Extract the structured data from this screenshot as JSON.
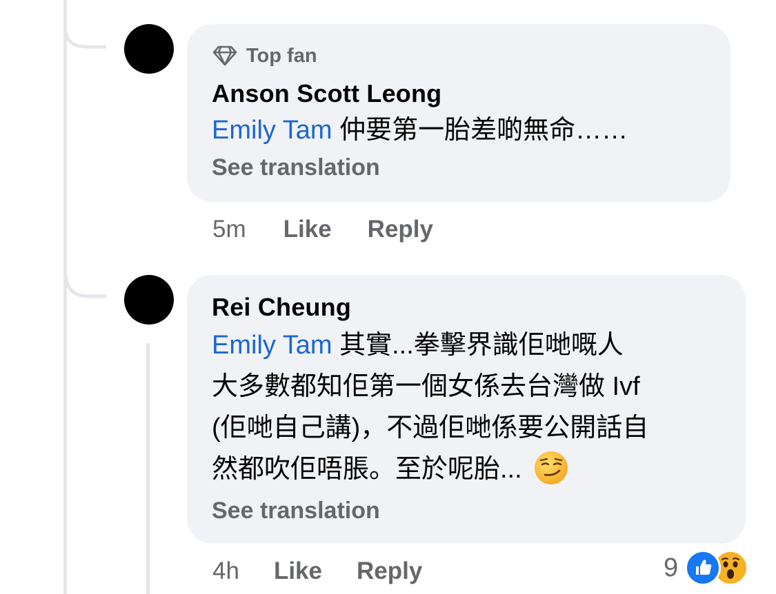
{
  "comments": [
    {
      "badge": "Top fan",
      "author": "Anson Scott Leong",
      "mention": "Emily Tam",
      "text": " 仲要第一胎差啲無命……",
      "see_translation": "See translation",
      "time": "5m",
      "like": "Like",
      "reply": "Reply"
    },
    {
      "author": "Rei Cheung",
      "mention": "Emily Tam",
      "lines": [
        " 其實...拳擊界識佢哋嘅人",
        "大多數都知佢第一個女係去台灣做 Ivf",
        "(佢哋自己講)，不過佢哋係要公開話自",
        "然都吹佢唔脹。至於呢胎... "
      ],
      "emoji": "smirking-face",
      "see_translation": "See translation",
      "time": "4h",
      "like": "Like",
      "reply": "Reply",
      "reaction_count": "9",
      "reactions": [
        "like",
        "wow"
      ]
    }
  ],
  "colors": {
    "mention": "#1b66d1",
    "bubble": "#f0f2f5",
    "secondary_text": "#65676b",
    "like_blue": "#1877f2",
    "wow_yellow": "#f7b125"
  }
}
